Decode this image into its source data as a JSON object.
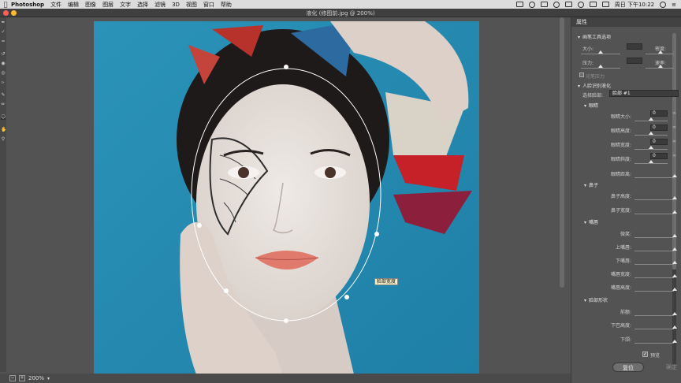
{
  "menubar": {
    "app_name": "Photoshop",
    "items": [
      "文件",
      "编辑",
      "图像",
      "图层",
      "文字",
      "选择",
      "滤镜",
      "3D",
      "视图",
      "窗口",
      "帮助"
    ],
    "clock": "周日 下午10:22"
  },
  "window": {
    "title": "液化 (修图前.jpg @ 200%)"
  },
  "canvas": {
    "zoom_label": "200%",
    "tooltip": "脸部宽度"
  },
  "panel": {
    "header": "属性",
    "brush_section": "画笔工具选项",
    "brush_size_label": "大小:",
    "brush_density_label": "密度:",
    "brush_pressure_label": "压力:",
    "brush_rate_label": "速率:",
    "stylus_label": "光笔压力",
    "face_section": "人脸识别液化",
    "select_face_label": "选择脸部:",
    "select_face_value": "脸部 #1",
    "eyes_section": "眼睛",
    "eye_size_label": "眼睛大小:",
    "eye_height_label": "眼睛高度:",
    "eye_width_label": "眼睛宽度:",
    "eye_tilt_label": "眼睛斜度:",
    "eye_distance_label": "眼睛距离:",
    "eye_size_value": "0",
    "eye_height_value": "0",
    "eye_width_value": "0",
    "eye_tilt_value": "0",
    "nose_section": "鼻子",
    "nose_height_label": "鼻子高度:",
    "nose_width_label": "鼻子宽度:",
    "mouth_section": "嘴唇",
    "smile_label": "微笑:",
    "upper_lip_label": "上嘴唇:",
    "lower_lip_label": "下嘴唇:",
    "mouth_width_label": "嘴唇宽度:",
    "mouth_height_label": "嘴唇高度:",
    "face_shape_section": "脸部形状",
    "forehead_label": "前额:",
    "chin_height_label": "下巴高度:",
    "jawline_label": "下颌:",
    "preview_label": "预览",
    "reset_label": "复位",
    "ok_label": "确定",
    "preview_checked": true
  }
}
